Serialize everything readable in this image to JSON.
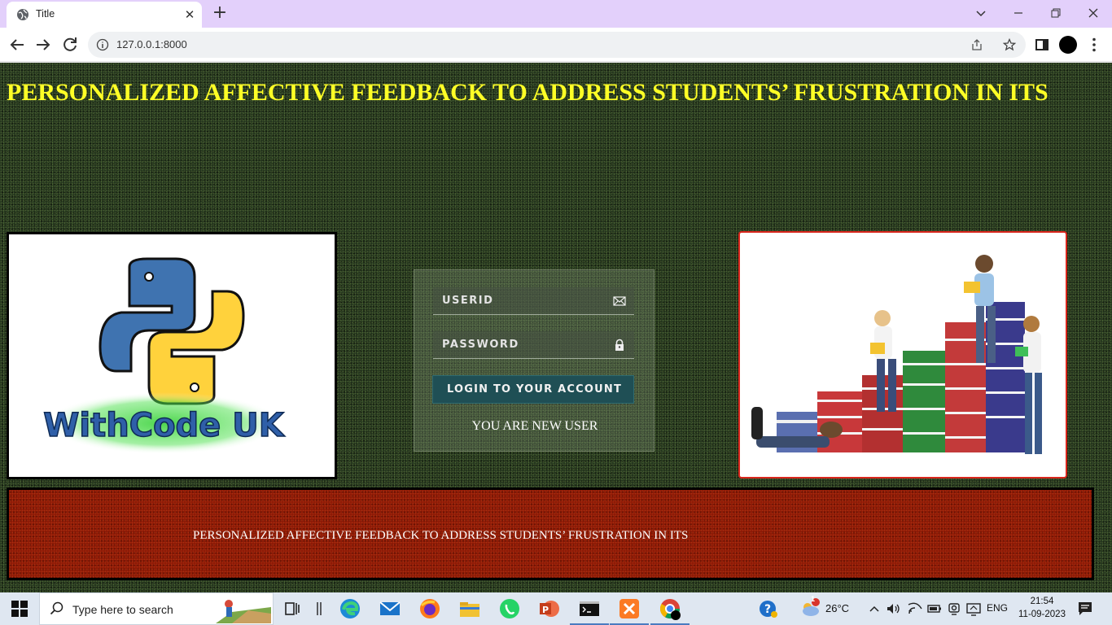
{
  "browser": {
    "tab_title": "Title",
    "url": "127.0.0.1:8000"
  },
  "page": {
    "heading": "PERSONALIZED AFFECTIVE FEEDBACK TO ADDRESS STUDENTS’ FRUSTRATION IN ITS",
    "heading_color": "#ffff26",
    "logo_caption": "WithCode UK"
  },
  "login": {
    "userid_placeholder": "USERID",
    "password_placeholder": "PASSWORD",
    "button_label": "LOGIN TO YOUR ACCOUNT",
    "new_user_link": "YOU ARE NEW USER",
    "button_color": "#1f4f55"
  },
  "footer": {
    "text": "PERSONALIZED AFFECTIVE FEEDBACK TO ADDRESS STUDENTS’ FRUSTRATION IN ITS",
    "band_color": "#8e1a06"
  },
  "taskbar": {
    "search_placeholder": "Type here to search",
    "weather": "26°C",
    "language": "ENG",
    "time": "21:54",
    "date": "11-09-2023",
    "weather_badge": "1"
  }
}
